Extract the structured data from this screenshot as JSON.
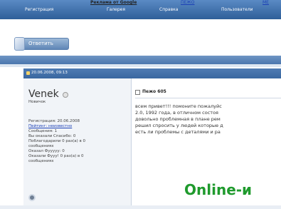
{
  "nav": {
    "items": [
      "Регистрация",
      "Галерея",
      "Справка",
      "Пользователи"
    ]
  },
  "ads": {
    "google_label": "Реклама от Google",
    "link1": "ПЕЖО",
    "link2": "ME"
  },
  "reply_button": {
    "label": "Ответить"
  },
  "post": {
    "date": "20.06.2008, 09:13",
    "author": {
      "name": "Venek",
      "rank": "Новичок",
      "details": [
        "Регистрация: 20.06.2008",
        "Пейтинг: неизвестно",
        "Сообщения: 1",
        "Вы оказали Спасибо: 0",
        "Поблагодарили 0 раз(а) в 0",
        "сообщениях",
        "Оказал Фууууу: 0",
        "Оказали Фууу! 0 раз(а) в 0",
        "сообщениях"
      ]
    },
    "title": "Пежо 605",
    "body": [
      "всем привет!!! помоните пожалуйс",
      "2.0, 1992 года, в отличном состоя",
      "довольно проблемная в плане рем",
      "решил спросить у людей которые д",
      "есть ли проблемы с деталями и ра"
    ]
  },
  "watermark": "Online-и"
}
